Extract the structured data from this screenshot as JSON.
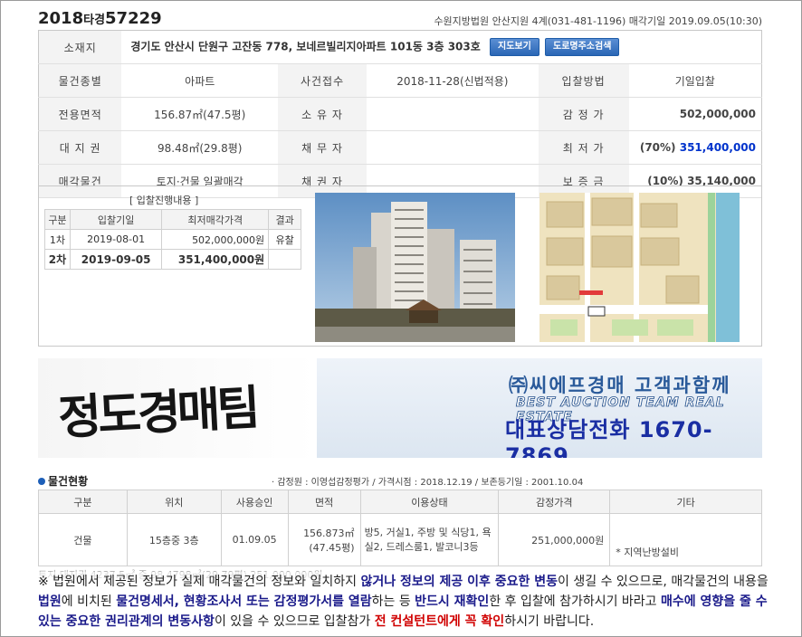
{
  "header": {
    "case_year": "2018",
    "case_mid": "타경",
    "case_no": "57229",
    "court_info": "수원지방법원 안산지원 4계(031-481-1196) 매각기일 2019.09.05(10:30)"
  },
  "info": {
    "address_label": "소재지",
    "address": "경기도 안산시 단원구 고잔동 778, 보네르빌리지아파트 101동 3층 303호",
    "map_btn": "지도보기",
    "road_btn": "도로명주소검색",
    "rows": [
      {
        "l1": "물건종별",
        "v1": "아파트",
        "l2": "사건접수",
        "v2": "2018-11-28(신법적용)",
        "l3": "입찰방법",
        "v3": "기일입찰"
      },
      {
        "l1": "전용면적",
        "v1": "156.87㎡(47.5평)",
        "l2": "소 유 자",
        "v2": "",
        "l3": "감 정 가",
        "v3": "502,000,000"
      },
      {
        "l1": "대 지 권",
        "v1": "98.48㎡(29.8평)",
        "l2": "채 무 자",
        "v2": "",
        "l3": "최 저 가",
        "v3a": "(70%)",
        "v3b": "351,400,000"
      },
      {
        "l1": "매각물건",
        "v1": "토지·건물 일괄매각",
        "l2": "채 권 자",
        "v2": "",
        "l3": "보 증 금",
        "v3": "(10%) 35,140,000"
      }
    ]
  },
  "bids": {
    "title": "[ 입찰진행내용 ]",
    "headers": [
      "구분",
      "입찰기일",
      "최저매각가격",
      "결과"
    ],
    "rows": [
      {
        "round": "1차",
        "date": "2019-08-01",
        "price": "502,000,000원",
        "result": "유찰"
      },
      {
        "round": "2차",
        "date": "2019-09-05",
        "price": "351,400,000원",
        "result": ""
      }
    ]
  },
  "banner": {
    "calligraphy": "정도경매팀",
    "line1": "㈜씨에프경매 고객과함께",
    "line2": "BEST AUCTION TEAM  REAL ESTATE",
    "line3": "대표상담전화 1670-7869"
  },
  "status": {
    "title": "물건현황",
    "meta": "· 감정원 : 이영섭감정평가 / 가격시점 : 2018.12.19 / 보존등기일 : 2001.10.04",
    "headers": [
      "구분",
      "위치",
      "사용승인",
      "면적",
      "이용상태",
      "감정가격",
      "기타"
    ],
    "row": {
      "kind": "건물",
      "loc": "15층중 3층",
      "approve": "01.09.05",
      "area1": "156.873㎡",
      "area2": "(47.45평)",
      "use": "방5, 거실1, 주방 및 식당1, 욕실2, 드레스룸1, 발코니3등",
      "price": "251,000,000원",
      "etc": "* 지역난방설비"
    },
    "ghost": "토지    대지권    4237.5㎡ 중 98.4798㎡(29.79평)    251,000,000원"
  },
  "notice": {
    "t1": "※ 법원에서 제공된 정보가 실제 매각물건의 정보와 일치하지 ",
    "b1": "않거나 정보의 제공 이후 중요한 변동",
    "t2": "이 생길 수 있으므로, 매각물건의 내용을 ",
    "b2": "법원",
    "t3": "에 비치된 ",
    "b3": "물건명세서, 현황조사서 또는 감정평가서를 열람",
    "t4": "하는 등 ",
    "b4": "반드시 재확인",
    "t5": "한 후 입찰에 참가하시기 바라고 ",
    "b5": "매수에 영향을 줄 수 있는 중요한 권리관계의 변동사항",
    "t6": "이 있을 수 있으므로 입찰참가 ",
    "r1": "전 컨설턴트에게 꼭 확인",
    "t7": "하시기 바랍니다."
  }
}
